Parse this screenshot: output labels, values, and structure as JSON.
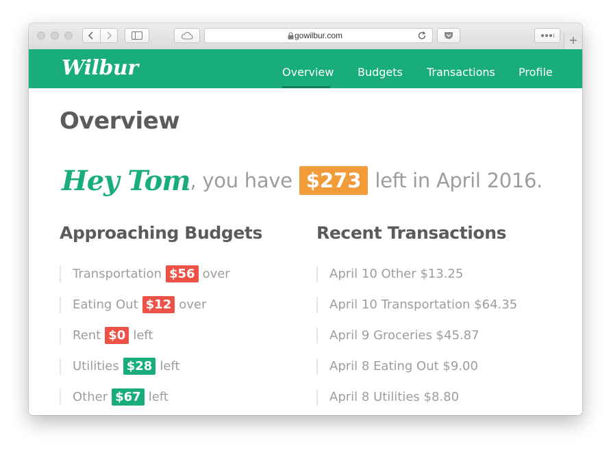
{
  "browser": {
    "url": "gowilbur.com",
    "new_tab": "+"
  },
  "header": {
    "logo": "Wilbur",
    "nav": [
      {
        "label": "Overview",
        "active": true
      },
      {
        "label": "Budgets",
        "active": false
      },
      {
        "label": "Transactions",
        "active": false
      },
      {
        "label": "Profile",
        "active": false
      }
    ]
  },
  "page": {
    "title": "Overview",
    "greeting": {
      "name": "Hey Tom",
      "pre": ", you have",
      "amount": "$273",
      "post": "left in April 2016."
    }
  },
  "budgets": {
    "title": "Approaching Budgets",
    "items": [
      {
        "label": "Transportation",
        "amount": "$56",
        "status": "over"
      },
      {
        "label": "Eating Out",
        "amount": "$12",
        "status": "over"
      },
      {
        "label": "Rent",
        "amount": "$0",
        "status": "left"
      },
      {
        "label": "Utilities",
        "amount": "$28",
        "status": "left"
      },
      {
        "label": "Other",
        "amount": "$67",
        "status": "left"
      }
    ]
  },
  "transactions": {
    "title": "Recent Transactions",
    "items": [
      "April 10 Other $13.25",
      "April 10 Transportation $64.35",
      "April 9 Groceries $45.87",
      "April 8 Eating Out $9.00",
      "April 8 Utilities $8.80"
    ]
  },
  "colors": {
    "brand": "#19ad7e",
    "over": "#ee5145",
    "highlight": "#f19b3b",
    "text": "#5b5b5b",
    "muted": "#9d9d9d"
  }
}
